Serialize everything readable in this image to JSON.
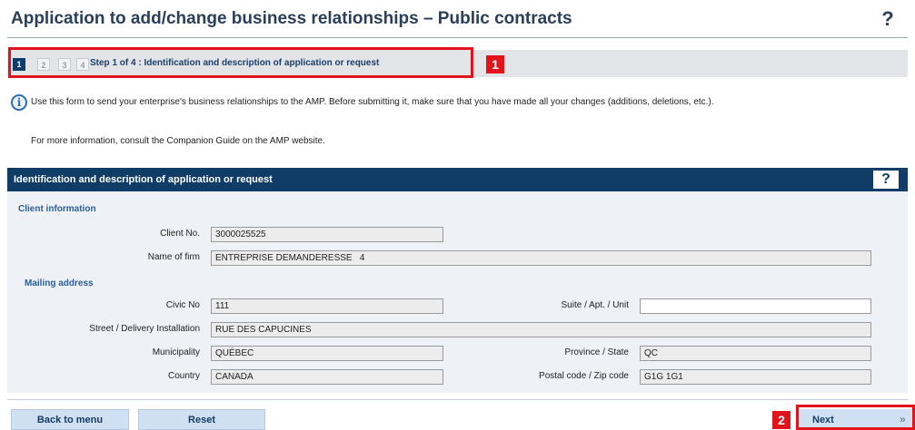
{
  "header": {
    "title": "Application to add/change business relationships – Public contracts",
    "help_label": "?"
  },
  "steps": {
    "items": [
      "1",
      "2",
      "3",
      "4"
    ],
    "active": "1",
    "current_text": "Step 1 of 4 : Identification and description of application or request",
    "badge": "1"
  },
  "info": {
    "icon": "info-icon",
    "glyph": "i",
    "text": "Use this form to send your enterprise's business relationships to the AMP. Before submitting it, make sure that you have made all your changes (additions, deletions, etc.).",
    "more": "For more information, consult the Companion Guide on the AMP website."
  },
  "section": {
    "title": "Identification and description of application or request",
    "help_label": "?"
  },
  "client_info": {
    "title": "Client information",
    "client_no_label": "Client No.",
    "client_no": "3000025525",
    "firm_label": "Name of firm",
    "firm": "ENTREPRISE DEMANDERESSE   4"
  },
  "mailing": {
    "title": "Mailing address",
    "civic_label": "Civic No",
    "civic": "111",
    "suite_label": "Suite / Apt. / Unit",
    "suite": "",
    "street_label": "Street / Delivery Installation",
    "street": "RUE DES CAPUCINES",
    "municipality_label": "Municipality",
    "municipality": "QUÉBEC",
    "province_label": "Province / State",
    "province": "QC",
    "country_label": "Country",
    "country": "CANADA",
    "postal_label": "Postal code / Zip code",
    "postal": "G1G 1G1"
  },
  "footer": {
    "back_label": "Back to menu",
    "reset_label": "Reset",
    "next_label": "Next",
    "next_badge": "2",
    "next_arrow": "»",
    "highlight_color": "#e3131b"
  }
}
